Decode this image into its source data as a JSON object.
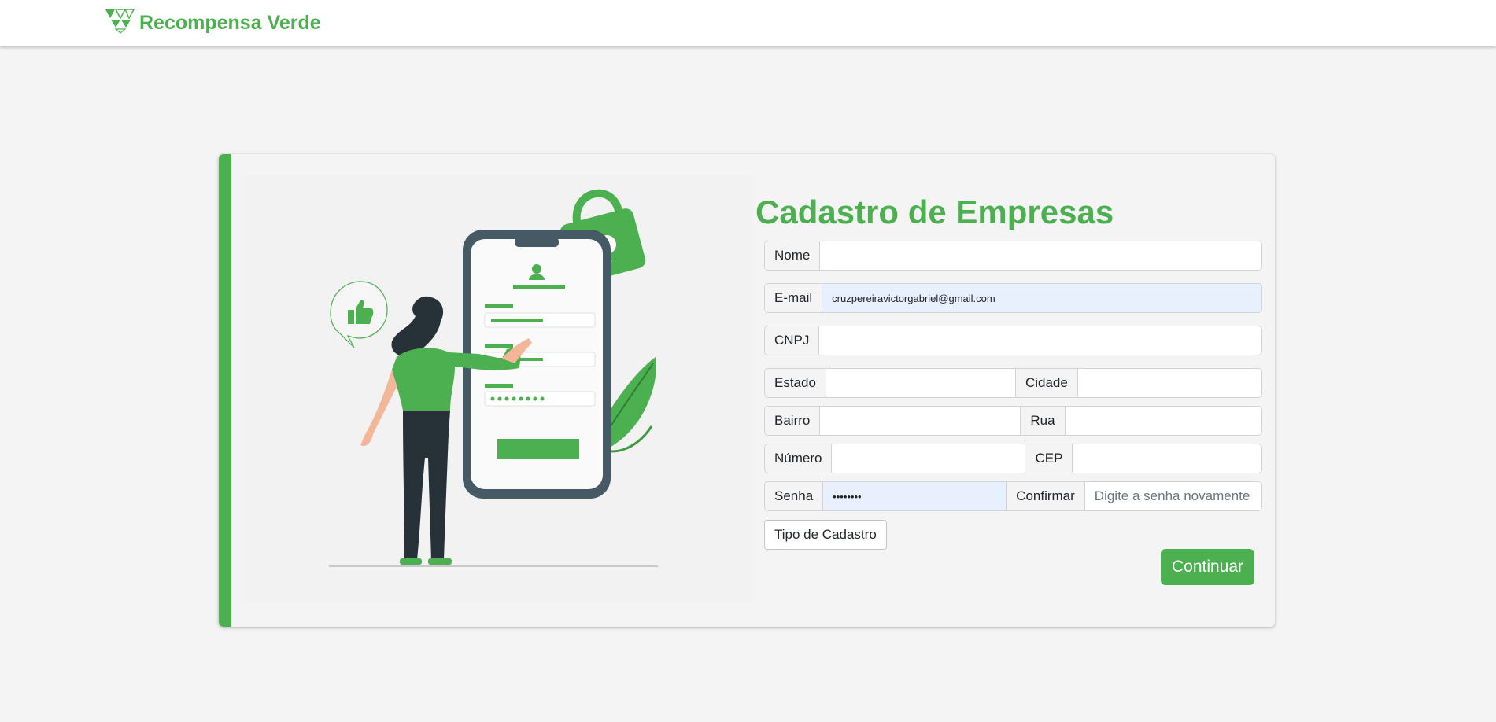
{
  "navbar": {
    "brand_name": "Recompensa Verde",
    "logo_icon": "triangles-logo-icon",
    "accent_color": "#4caf50"
  },
  "illustration": {
    "icon": "signup-phone-illustration",
    "colors": {
      "primary": "#4caf50",
      "dark": "#263238",
      "phone": "#455a64"
    }
  },
  "form": {
    "title": "Cadastro de Empresas",
    "nome": {
      "label": "Nome",
      "value": ""
    },
    "email": {
      "label": "E-mail",
      "value": "cruzpereiravictorgabriel@gmail.com"
    },
    "cnpj": {
      "label": "CNPJ",
      "value": ""
    },
    "estado": {
      "label": "Estado",
      "value": ""
    },
    "cidade": {
      "label": "Cidade",
      "value": ""
    },
    "bairro": {
      "label": "Bairro",
      "value": ""
    },
    "rua": {
      "label": "Rua",
      "value": ""
    },
    "numero": {
      "label": "Número",
      "value": ""
    },
    "cep": {
      "label": "CEP",
      "value": ""
    },
    "senha": {
      "label": "Senha",
      "value": "••••••••"
    },
    "confirmar": {
      "label": "Confirmar",
      "value": "",
      "placeholder": "Digite a senha novamente"
    },
    "tipo_button": "Tipo de Cadastro",
    "submit_button": "Continuar",
    "autofill_color": "#e8f0fe"
  }
}
